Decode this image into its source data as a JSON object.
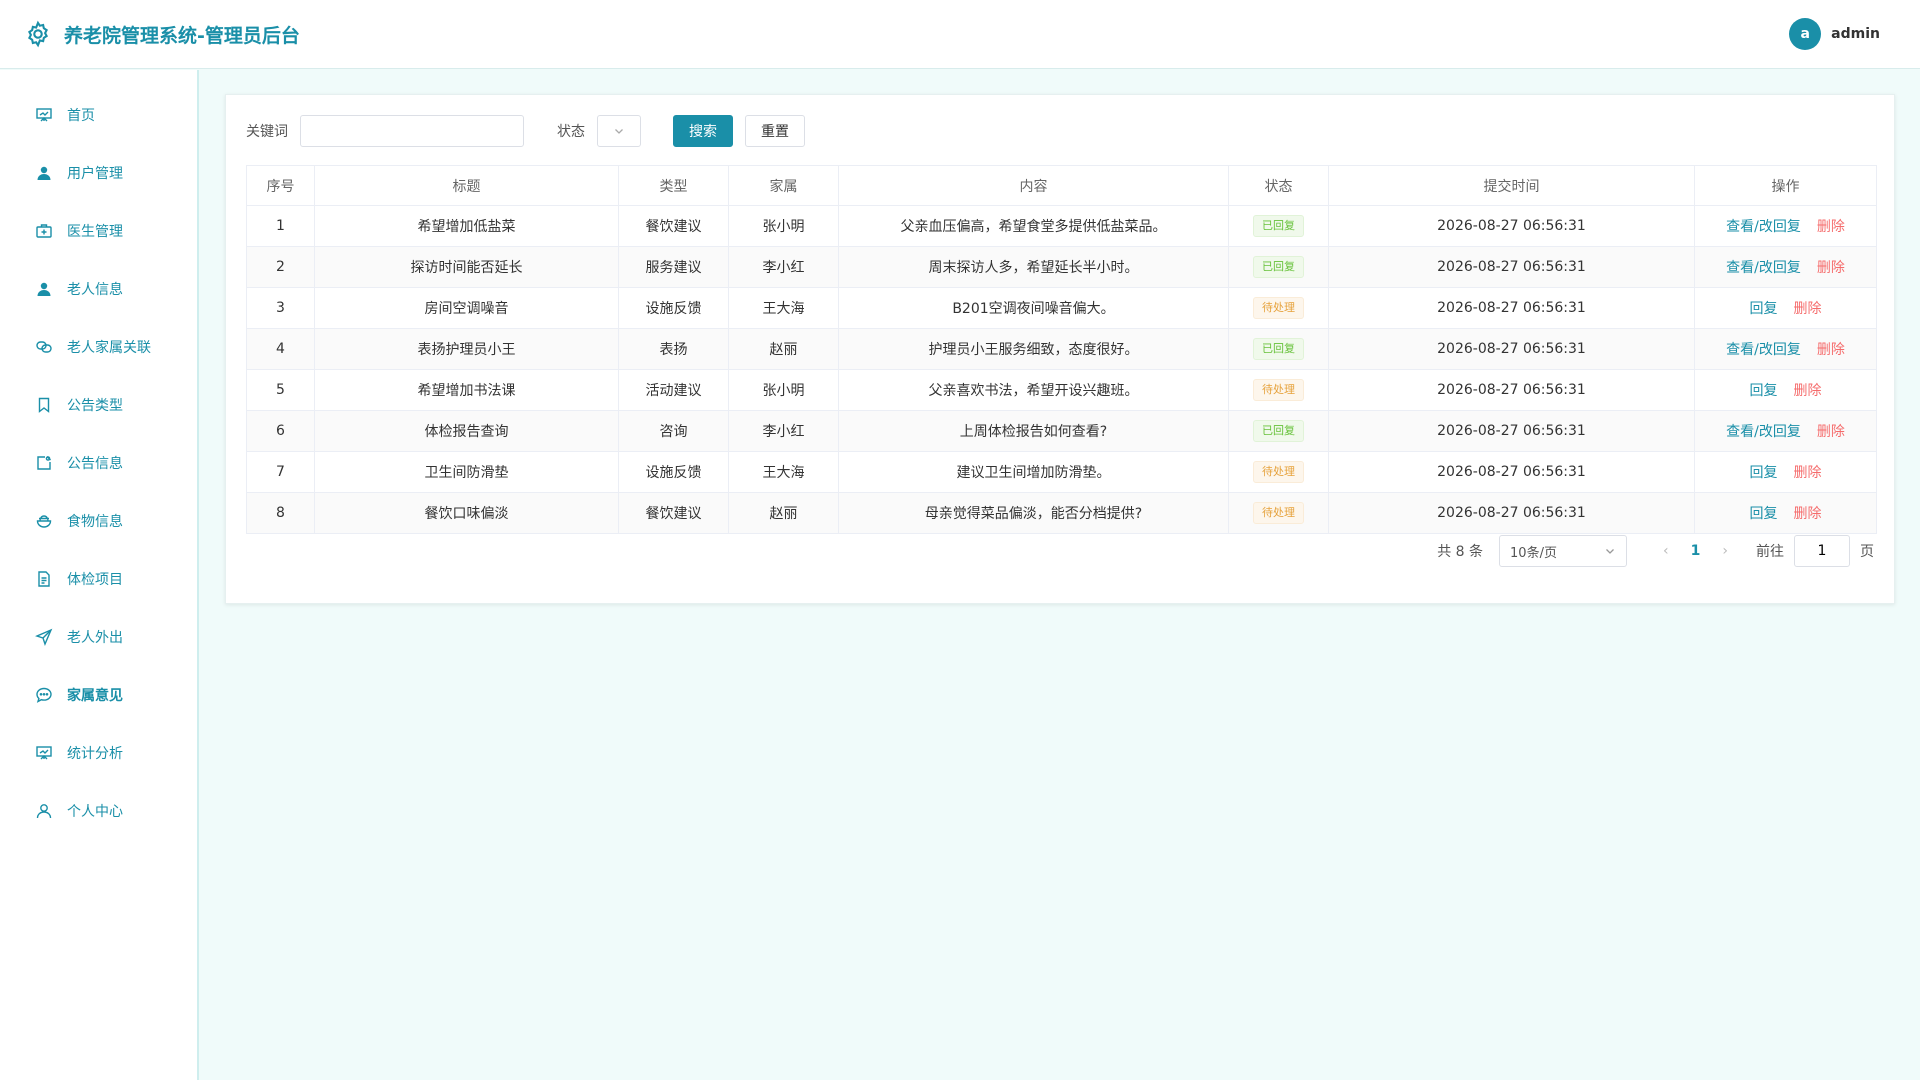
{
  "header": {
    "app_title": "养老院管理系统-管理员后台",
    "avatar_letter": "a",
    "username": "admin"
  },
  "sidebar": {
    "items": [
      {
        "label": "首页",
        "icon": "presentation-icon"
      },
      {
        "label": "用户管理",
        "icon": "user-filled-icon"
      },
      {
        "label": "医生管理",
        "icon": "first-aid-kit-icon"
      },
      {
        "label": "老人信息",
        "icon": "user-filled-icon"
      },
      {
        "label": "老人家属关联",
        "icon": "link-icon"
      },
      {
        "label": "公告类型",
        "icon": "bookmark-icon"
      },
      {
        "label": "公告信息",
        "icon": "notice-icon"
      },
      {
        "label": "食物信息",
        "icon": "food-bowl-icon"
      },
      {
        "label": "体检项目",
        "icon": "document-icon"
      },
      {
        "label": "老人外出",
        "icon": "send-arrow-icon"
      },
      {
        "label": "家属意见",
        "icon": "chat-bubble-icon"
      },
      {
        "label": "统计分析",
        "icon": "presentation-icon"
      },
      {
        "label": "个人中心",
        "icon": "user-outline-icon"
      }
    ],
    "active_index": 10
  },
  "filters": {
    "keyword_label": "关键词",
    "keyword_value": "",
    "status_label": "状态",
    "search_label": "搜索",
    "reset_label": "重置"
  },
  "table": {
    "headers": [
      "序号",
      "标题",
      "类型",
      "家属",
      "内容",
      "状态",
      "提交时间",
      "操作"
    ],
    "rows": [
      {
        "no": "1",
        "title": "希望增加低盐菜",
        "type": "餐饮建议",
        "family": "张小明",
        "content": "父亲血压偏高，希望食堂多提供低盐菜品。",
        "status": "已回复",
        "status_kind": "done",
        "time": "2026-08-27 06:56:31",
        "action": "查看/改回复",
        "delete": "删除"
      },
      {
        "no": "2",
        "title": "探访时间能否延长",
        "type": "服务建议",
        "family": "李小红",
        "content": "周末探访人多，希望延长半小时。",
        "status": "已回复",
        "status_kind": "done",
        "time": "2026-08-27 06:56:31",
        "action": "查看/改回复",
        "delete": "删除"
      },
      {
        "no": "3",
        "title": "房间空调噪音",
        "type": "设施反馈",
        "family": "王大海",
        "content": "B201空调夜间噪音偏大。",
        "status": "待处理",
        "status_kind": "wait",
        "time": "2026-08-27 06:56:31",
        "action": "回复",
        "delete": "删除"
      },
      {
        "no": "4",
        "title": "表扬护理员小王",
        "type": "表扬",
        "family": "赵丽",
        "content": "护理员小王服务细致，态度很好。",
        "status": "已回复",
        "status_kind": "done",
        "time": "2026-08-27 06:56:31",
        "action": "查看/改回复",
        "delete": "删除"
      },
      {
        "no": "5",
        "title": "希望增加书法课",
        "type": "活动建议",
        "family": "张小明",
        "content": "父亲喜欢书法，希望开设兴趣班。",
        "status": "待处理",
        "status_kind": "wait",
        "time": "2026-08-27 06:56:31",
        "action": "回复",
        "delete": "删除"
      },
      {
        "no": "6",
        "title": "体检报告查询",
        "type": "咨询",
        "family": "李小红",
        "content": "上周体检报告如何查看?",
        "status": "已回复",
        "status_kind": "done",
        "time": "2026-08-27 06:56:31",
        "action": "查看/改回复",
        "delete": "删除"
      },
      {
        "no": "7",
        "title": "卫生间防滑垫",
        "type": "设施反馈",
        "family": "王大海",
        "content": "建议卫生间增加防滑垫。",
        "status": "待处理",
        "status_kind": "wait",
        "time": "2026-08-27 06:56:31",
        "action": "回复",
        "delete": "删除"
      },
      {
        "no": "8",
        "title": "餐饮口味偏淡",
        "type": "餐饮建议",
        "family": "赵丽",
        "content": "母亲觉得菜品偏淡，能否分档提供?",
        "status": "待处理",
        "status_kind": "wait",
        "time": "2026-08-27 06:56:31",
        "action": "回复",
        "delete": "删除"
      }
    ]
  },
  "pagination": {
    "total_text": "共 8 条",
    "page_size": "10条/页",
    "current_page": "1",
    "goto_label": "前往",
    "goto_value": "1",
    "page_suffix": "页"
  },
  "colors": {
    "accent": "#1a8fa8",
    "background": "#f0fbfa",
    "tag_done": "#67c23a",
    "tag_wait": "#e6a23c",
    "danger": "#f56c6c"
  }
}
